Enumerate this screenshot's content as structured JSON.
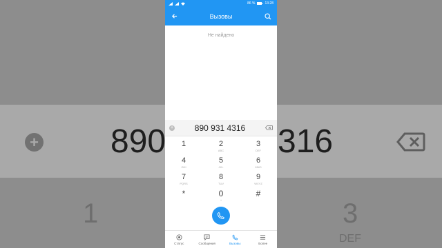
{
  "background": {
    "number_left": "890",
    "number_right": "316",
    "digit_left": "1",
    "digit_right": "3",
    "letters_right": "DEF"
  },
  "statusbar": {
    "battery": "86 %",
    "time": "13:28"
  },
  "appbar": {
    "title": "Вызовы",
    "back_icon": "arrow-left-icon",
    "search_icon": "search-icon"
  },
  "content": {
    "empty_text": "Не найдено"
  },
  "dialer": {
    "number": "890 931 4316",
    "keys": [
      {
        "digit": "1",
        "letters": ""
      },
      {
        "digit": "2",
        "letters": "ABC"
      },
      {
        "digit": "3",
        "letters": "DEF"
      },
      {
        "digit": "4",
        "letters": "GHI"
      },
      {
        "digit": "5",
        "letters": "JKL"
      },
      {
        "digit": "6",
        "letters": "MNO"
      },
      {
        "digit": "7",
        "letters": "PQRS"
      },
      {
        "digit": "8",
        "letters": "TUV"
      },
      {
        "digit": "9",
        "letters": "WXYZ"
      },
      {
        "digit": "*",
        "letters": ""
      },
      {
        "digit": "0",
        "letters": "+"
      },
      {
        "digit": "#",
        "letters": ""
      }
    ]
  },
  "nav": {
    "items": [
      {
        "label": "Статус",
        "icon": "status-icon",
        "active": false
      },
      {
        "label": "Сообщения",
        "icon": "message-icon",
        "active": false
      },
      {
        "label": "Вызовы",
        "icon": "phone-icon",
        "active": true
      },
      {
        "label": "Более",
        "icon": "menu-icon",
        "active": false
      }
    ]
  },
  "colors": {
    "accent": "#2196f3"
  }
}
